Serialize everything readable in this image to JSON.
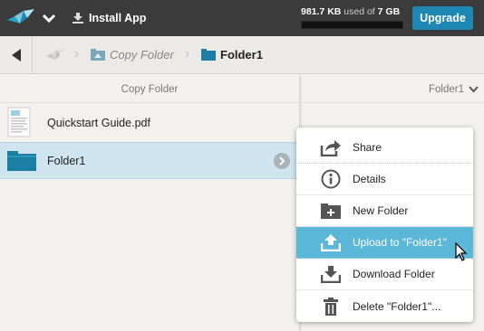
{
  "topbar": {
    "install_label": "Install App",
    "quota_used": "981.7 KB",
    "quota_mid": "used of",
    "quota_total": "7 GB",
    "quota_fraction": 0.00014,
    "upgrade_label": "Upgrade"
  },
  "breadcrumb": {
    "items": [
      "Copy Folder",
      "Folder1"
    ]
  },
  "columns": {
    "left_header": "Copy Folder",
    "right_header": "Folder1"
  },
  "files": [
    {
      "name": "Quickstart Guide.pdf",
      "type": "pdf-file-icon"
    },
    {
      "name": "Folder1",
      "type": "folder-icon",
      "selected": true
    }
  ],
  "context_menu": {
    "items": [
      {
        "label": "Share",
        "icon": "share-icon"
      },
      {
        "label": "Details",
        "icon": "info-icon"
      },
      {
        "label": "New Folder",
        "icon": "new-folder-icon"
      },
      {
        "label": "Upload to \"Folder1\"",
        "icon": "upload-icon",
        "active": true
      },
      {
        "label": "Download Folder",
        "icon": "download-icon"
      },
      {
        "label": "Delete \"Folder1\"...",
        "icon": "trash-icon"
      }
    ]
  },
  "colors": {
    "topbar": "#3b3b3b",
    "accent": "#1e88b5",
    "selected_row": "#cfe4ee",
    "menu_highlight": "#5bb7d8",
    "folder": "#1a7fa3"
  }
}
